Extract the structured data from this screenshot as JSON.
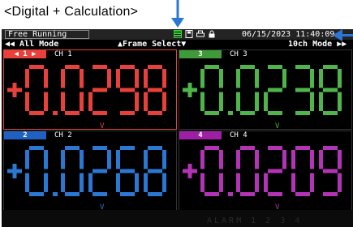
{
  "caption": "<Digital + Calculation>",
  "status": {
    "mode": "Free Running",
    "datetime": "06/15/2023 11:40:09"
  },
  "modebar": {
    "left": "◀◀ All Mode",
    "mid": "▲Frame Select▼",
    "right": "10ch Mode ▶▶"
  },
  "channels": [
    {
      "num_label": "◀  1  ▶",
      "name": "CH 1",
      "value": "+0.0298",
      "unit": "V",
      "color": "#e8403a",
      "tab_color": "#e8403a",
      "selected": true
    },
    {
      "num_label": "3",
      "name": "CH 3",
      "value": "+0.0238",
      "unit": "V",
      "color": "#4fb54a",
      "tab_color": "#3f9a3a",
      "selected": false
    },
    {
      "num_label": "2",
      "name": "CH 2",
      "value": "+0.0268",
      "unit": "V",
      "color": "#2a78d2",
      "tab_color": "#1f60c0",
      "selected": false
    },
    {
      "num_label": "4",
      "name": "CH 4",
      "value": "+0.0209",
      "unit": "V",
      "color": "#b233b5",
      "tab_color": "#9d1fa3",
      "selected": false
    }
  ],
  "alarm": {
    "label": "ALARM 1 2 3 4"
  },
  "icons": [
    "list-icon",
    "memory-card-icon",
    "printer-icon",
    "lock-icon"
  ]
}
